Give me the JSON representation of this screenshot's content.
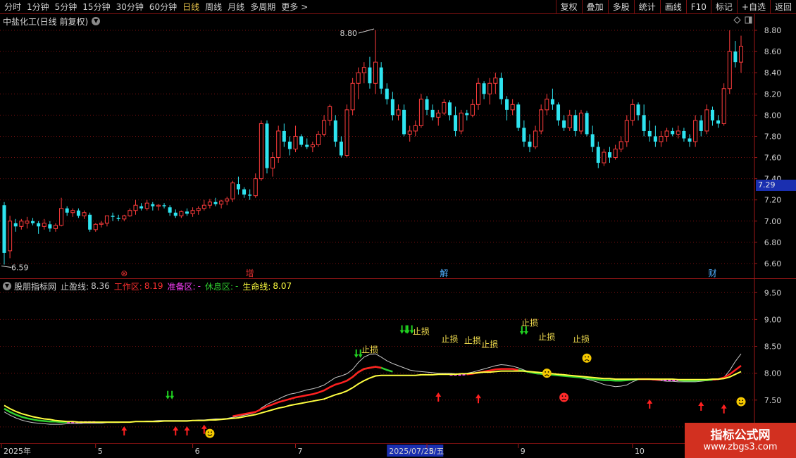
{
  "toolbar": {
    "period_tabs": [
      "分时",
      "1分钟",
      "5分钟",
      "15分钟",
      "30分钟",
      "60分钟",
      "日线",
      "周线",
      "月线",
      "多周期",
      "更多"
    ],
    "active_tab": "日线",
    "buttons": [
      "复权",
      "叠加",
      "多股",
      "统计",
      "画线",
      "F10",
      "标记",
      "+自选",
      "返回"
    ]
  },
  "main_chart": {
    "title": "中盐化工(日线 前复权)",
    "current_price": "7.29",
    "high_label": "8.80",
    "low_label": "6.59",
    "event_markers": [
      {
        "text": "⊗",
        "color": "#e03030",
        "index": 21
      },
      {
        "text": "增",
        "color": "#e03030",
        "index": 43
      },
      {
        "text": "解",
        "color": "#4fb0ff",
        "index": 77
      },
      {
        "text": "财",
        "color": "#4fb0ff",
        "index": 124
      }
    ]
  },
  "indicator": {
    "name": "股朋指标网",
    "stop_profit_label": "止盈线:",
    "stop_profit_value": "8.36",
    "work_label": "工作区:",
    "work_value": "8.19",
    "prep_label": "准备区:",
    "prep_value": "-",
    "rest_label": "休息区:",
    "rest_value": "-",
    "life_label": "生命线:",
    "life_value": "8.07",
    "stop_loss_text": "止损",
    "colors": {
      "work": "#ff2020",
      "prep": "#ff40ff",
      "rest": "#30d030",
      "life": "#ffff40",
      "stop_profit": "#c8c8c8"
    }
  },
  "date_axis": {
    "labels": [
      {
        "text": "2025年",
        "index": 0
      },
      {
        "text": "5",
        "index": 16
      },
      {
        "text": "6",
        "index": 33
      },
      {
        "text": "7",
        "index": 51
      },
      {
        "text": "2025/07/25/五",
        "index": 67,
        "highlight": true
      },
      {
        "text": "8",
        "index": 74
      },
      {
        "text": "9",
        "index": 90
      },
      {
        "text": "10",
        "index": 110
      },
      {
        "text": "11",
        "index": 123
      }
    ]
  },
  "watermark": {
    "line1": "指标公式网",
    "line2": "www.zbgs3.com"
  },
  "chart_data": {
    "type": "candlestick",
    "ylim": [
      6.52,
      8.9
    ],
    "yticks": [
      6.6,
      6.8,
      7.0,
      7.2,
      7.4,
      7.6,
      7.8,
      8.0,
      8.2,
      8.4,
      8.6,
      8.8
    ],
    "indicator_ylim": [
      6.75,
      9.7
    ],
    "indicator_yticks": [
      7.0,
      7.5,
      8.0,
      8.5,
      9.0,
      9.5
    ],
    "candles_ohlc": [
      [
        7.15,
        7.18,
        6.59,
        6.7
      ],
      [
        6.72,
        7.05,
        6.65,
        7.0
      ],
      [
        6.98,
        7.02,
        6.9,
        6.95
      ],
      [
        6.95,
        7.02,
        6.92,
        7.0
      ],
      [
        6.98,
        7.04,
        6.93,
        7.0
      ],
      [
        7.0,
        7.03,
        6.96,
        6.98
      ],
      [
        6.98,
        7.0,
        6.88,
        6.95
      ],
      [
        6.95,
        7.02,
        6.92,
        6.98
      ],
      [
        6.97,
        7.0,
        6.9,
        6.93
      ],
      [
        6.93,
        6.98,
        6.9,
        6.96
      ],
      [
        6.96,
        7.22,
        6.95,
        7.12
      ],
      [
        7.12,
        7.14,
        7.05,
        7.08
      ],
      [
        7.08,
        7.12,
        7.04,
        7.1
      ],
      [
        7.1,
        7.12,
        7.03,
        7.05
      ],
      [
        7.05,
        7.1,
        7.02,
        7.08
      ],
      [
        7.06,
        7.08,
        6.9,
        6.92
      ],
      [
        6.92,
        6.98,
        6.9,
        6.97
      ],
      [
        6.97,
        7.0,
        6.94,
        6.98
      ],
      [
        6.98,
        7.04,
        6.95,
        7.05
      ],
      [
        7.05,
        7.08,
        7.0,
        7.04
      ],
      [
        7.03,
        7.06,
        7.0,
        7.02
      ],
      [
        7.02,
        7.06,
        7.0,
        7.05
      ],
      [
        7.05,
        7.12,
        7.04,
        7.1
      ],
      [
        7.1,
        7.2,
        7.06,
        7.15
      ],
      [
        7.14,
        7.17,
        7.1,
        7.12
      ],
      [
        7.12,
        7.2,
        7.1,
        7.17
      ],
      [
        7.16,
        7.18,
        7.1,
        7.14
      ],
      [
        7.14,
        7.16,
        7.1,
        7.15
      ],
      [
        7.15,
        7.17,
        7.12,
        7.14
      ],
      [
        7.13,
        7.15,
        7.05,
        7.08
      ],
      [
        7.08,
        7.11,
        7.03,
        7.05
      ],
      [
        7.05,
        7.1,
        7.03,
        7.09
      ],
      [
        7.09,
        7.12,
        7.05,
        7.07
      ],
      [
        7.07,
        7.13,
        7.04,
        7.1
      ],
      [
        7.1,
        7.14,
        7.06,
        7.12
      ],
      [
        7.12,
        7.2,
        7.1,
        7.15
      ],
      [
        7.15,
        7.21,
        7.12,
        7.18
      ],
      [
        7.18,
        7.22,
        7.14,
        7.16
      ],
      [
        7.16,
        7.2,
        7.12,
        7.19
      ],
      [
        7.19,
        7.23,
        7.15,
        7.21
      ],
      [
        7.21,
        7.38,
        7.18,
        7.36
      ],
      [
        7.35,
        7.42,
        7.25,
        7.3
      ],
      [
        7.3,
        7.32,
        7.22,
        7.25
      ],
      [
        7.25,
        7.3,
        7.2,
        7.24
      ],
      [
        7.24,
        7.45,
        7.22,
        7.4
      ],
      [
        7.4,
        7.95,
        7.38,
        7.92
      ],
      [
        7.92,
        7.95,
        7.45,
        7.5
      ],
      [
        7.5,
        7.65,
        7.42,
        7.6
      ],
      [
        7.6,
        7.9,
        7.55,
        7.85
      ],
      [
        7.85,
        7.92,
        7.7,
        7.75
      ],
      [
        7.75,
        7.8,
        7.62,
        7.68
      ],
      [
        7.68,
        7.9,
        7.65,
        7.8
      ],
      [
        7.8,
        7.82,
        7.7,
        7.72
      ],
      [
        7.72,
        7.78,
        7.68,
        7.7
      ],
      [
        7.7,
        7.75,
        7.65,
        7.72
      ],
      [
        7.72,
        7.85,
        7.7,
        7.82
      ],
      [
        7.82,
        8.0,
        7.8,
        7.95
      ],
      [
        7.95,
        8.1,
        7.9,
        8.08
      ],
      [
        7.95,
        8.0,
        7.7,
        7.75
      ],
      [
        7.75,
        7.8,
        7.6,
        7.62
      ],
      [
        7.62,
        8.1,
        7.6,
        8.05
      ],
      [
        8.05,
        8.35,
        8.0,
        8.3
      ],
      [
        8.3,
        8.45,
        8.15,
        8.4
      ],
      [
        8.4,
        8.5,
        8.3,
        8.45
      ],
      [
        8.45,
        8.55,
        8.25,
        8.3
      ],
      [
        8.3,
        8.8,
        8.2,
        8.5
      ],
      [
        8.45,
        8.5,
        8.2,
        8.25
      ],
      [
        8.25,
        8.3,
        8.1,
        8.15
      ],
      [
        8.15,
        8.22,
        7.95,
        8.0
      ],
      [
        8.0,
        8.1,
        7.95,
        8.05
      ],
      [
        8.05,
        8.1,
        7.8,
        7.82
      ],
      [
        7.82,
        7.9,
        7.75,
        7.85
      ],
      [
        7.85,
        7.95,
        7.8,
        7.9
      ],
      [
        7.9,
        8.2,
        7.88,
        8.15
      ],
      [
        8.15,
        8.18,
        8.0,
        8.05
      ],
      [
        8.05,
        8.1,
        7.95,
        7.98
      ],
      [
        7.98,
        8.05,
        7.9,
        8.02
      ],
      [
        8.02,
        8.15,
        8.0,
        8.12
      ],
      [
        8.12,
        8.14,
        7.95,
        8.0
      ],
      [
        8.0,
        8.08,
        7.8,
        7.85
      ],
      [
        7.85,
        8.05,
        7.82,
        8.02
      ],
      [
        8.02,
        8.05,
        7.95,
        8.0
      ],
      [
        8.0,
        8.15,
        7.98,
        8.1
      ],
      [
        8.1,
        8.35,
        8.05,
        8.3
      ],
      [
        8.3,
        8.32,
        8.15,
        8.2
      ],
      [
        8.2,
        8.35,
        8.1,
        8.3
      ],
      [
        8.3,
        8.4,
        8.2,
        8.35
      ],
      [
        8.35,
        8.4,
        8.1,
        8.15
      ],
      [
        8.15,
        8.18,
        7.95,
        8.05
      ],
      [
        8.05,
        8.15,
        8.0,
        8.1
      ],
      [
        8.1,
        8.12,
        7.85,
        7.88
      ],
      [
        7.88,
        7.95,
        7.7,
        7.75
      ],
      [
        7.75,
        7.82,
        7.65,
        7.7
      ],
      [
        7.7,
        7.9,
        7.68,
        7.85
      ],
      [
        7.85,
        8.1,
        7.82,
        8.05
      ],
      [
        8.05,
        8.2,
        8.0,
        8.15
      ],
      [
        8.15,
        8.25,
        8.05,
        8.1
      ],
      [
        8.1,
        8.12,
        7.9,
        7.95
      ],
      [
        7.95,
        8.0,
        7.85,
        7.88
      ],
      [
        7.88,
        8.05,
        7.85,
        8.0
      ],
      [
        8.0,
        8.05,
        7.8,
        7.85
      ],
      [
        7.85,
        8.05,
        7.82,
        8.02
      ],
      [
        8.02,
        8.04,
        7.8,
        7.82
      ],
      [
        7.82,
        7.9,
        7.65,
        7.7
      ],
      [
        7.7,
        7.75,
        7.5,
        7.55
      ],
      [
        7.55,
        7.68,
        7.52,
        7.65
      ],
      [
        7.65,
        7.7,
        7.55,
        7.6
      ],
      [
        7.6,
        7.72,
        7.58,
        7.68
      ],
      [
        7.68,
        7.8,
        7.65,
        7.75
      ],
      [
        7.75,
        8.0,
        7.7,
        7.95
      ],
      [
        7.95,
        8.15,
        7.9,
        8.1
      ],
      [
        8.1,
        8.12,
        7.95,
        8.0
      ],
      [
        8.0,
        8.1,
        7.8,
        7.85
      ],
      [
        7.85,
        7.95,
        7.75,
        7.8
      ],
      [
        7.8,
        7.9,
        7.7,
        7.75
      ],
      [
        7.75,
        7.85,
        7.7,
        7.8
      ],
      [
        7.8,
        7.88,
        7.75,
        7.85
      ],
      [
        7.85,
        7.88,
        7.8,
        7.82
      ],
      [
        7.82,
        7.9,
        7.78,
        7.85
      ],
      [
        7.85,
        7.88,
        7.75,
        7.78
      ],
      [
        7.78,
        7.82,
        7.7,
        7.75
      ],
      [
        7.75,
        8.0,
        7.7,
        7.95
      ],
      [
        7.95,
        8.0,
        7.8,
        7.85
      ],
      [
        7.85,
        8.1,
        7.82,
        8.05
      ],
      [
        8.05,
        8.08,
        7.9,
        7.95
      ],
      [
        7.95,
        8.0,
        7.88,
        7.92
      ],
      [
        7.92,
        8.3,
        7.9,
        8.25
      ],
      [
        8.25,
        8.8,
        8.2,
        8.6
      ],
      [
        8.6,
        8.7,
        8.45,
        8.5
      ],
      [
        8.5,
        8.75,
        8.4,
        8.65
      ]
    ],
    "stop_profit_line": [
      7.28,
      7.22,
      7.17,
      7.13,
      7.1,
      7.08,
      7.07,
      7.06,
      7.05,
      7.05,
      7.05,
      7.06,
      7.06,
      7.06,
      7.07,
      7.07,
      7.07,
      7.07,
      7.08,
      7.08,
      7.08,
      7.09,
      7.09,
      7.1,
      7.1,
      7.11,
      7.11,
      7.12,
      7.12,
      7.12,
      7.12,
      7.12,
      7.12,
      7.12,
      7.13,
      7.13,
      7.14,
      7.15,
      7.15,
      7.16,
      7.18,
      7.2,
      7.22,
      7.24,
      7.27,
      7.35,
      7.42,
      7.47,
      7.52,
      7.57,
      7.61,
      7.63,
      7.66,
      7.69,
      7.71,
      7.74,
      7.78,
      7.85,
      7.92,
      7.95,
      7.99,
      8.07,
      8.2,
      8.3,
      8.35,
      8.36,
      8.3,
      8.23,
      8.18,
      8.14,
      8.1,
      8.06,
      8.04,
      8.03,
      8.02,
      8.01,
      8.0,
      8.0,
      8.0,
      7.99,
      7.99,
      8.0,
      8.02,
      8.05,
      8.08,
      8.11,
      8.14,
      8.16,
      8.15,
      8.13,
      8.1,
      8.06,
      8.02,
      7.99,
      7.98,
      7.98,
      7.98,
      7.97,
      7.96,
      7.95,
      7.93,
      7.91,
      7.89,
      7.86,
      7.83,
      7.79,
      7.77,
      7.75,
      7.76,
      7.78,
      7.84,
      7.88,
      7.89,
      7.88,
      7.87,
      7.86,
      7.85,
      7.85,
      7.84,
      7.84,
      7.84,
      7.84,
      7.85,
      7.86,
      7.87,
      7.88,
      7.92,
      8.05,
      8.22,
      8.36
    ],
    "work_line": [
      7.34,
      7.28,
      7.23,
      7.19,
      7.16,
      7.14,
      7.12,
      7.11,
      7.1,
      7.1,
      7.09,
      7.09,
      7.09,
      7.09,
      7.09,
      7.09,
      7.09,
      7.09,
      7.09,
      7.09,
      7.09,
      7.09,
      7.1,
      7.1,
      7.1,
      7.1,
      7.11,
      7.11,
      7.11,
      7.12,
      7.12,
      7.12,
      7.12,
      7.13,
      7.13,
      7.14,
      7.15,
      7.16,
      7.17,
      7.18,
      7.2,
      7.22,
      7.24,
      7.26,
      7.28,
      7.33,
      7.38,
      7.42,
      7.46,
      7.49,
      7.52,
      7.55,
      7.57,
      7.59,
      7.61,
      7.64,
      7.68,
      7.74,
      7.79,
      7.82,
      7.86,
      7.93,
      8.02,
      8.08,
      8.1,
      8.12,
      8.1,
      8.06,
      8.03,
      8.0,
      7.98,
      7.97,
      7.96,
      7.96,
      7.96,
      7.96,
      7.96,
      7.96,
      7.97,
      7.97,
      7.97,
      7.98,
      7.99,
      8.01,
      8.03,
      8.05,
      8.07,
      8.08,
      8.08,
      8.08,
      8.06,
      8.04,
      8.02,
      8.0,
      7.99,
      7.98,
      7.97,
      7.96,
      7.95,
      7.94,
      7.93,
      7.92,
      7.91,
      7.89,
      7.88,
      7.87,
      7.87,
      7.86,
      7.86,
      7.87,
      7.88,
      7.89,
      7.89,
      7.89,
      7.88,
      7.88,
      7.87,
      7.87,
      7.87,
      7.86,
      7.86,
      7.86,
      7.87,
      7.87,
      7.88,
      7.89,
      7.92,
      7.98,
      8.06,
      8.14
    ],
    "work_segments": [
      [
        40,
        66
      ],
      [
        81,
        90
      ],
      [
        111,
        115
      ],
      [
        124,
        135
      ]
    ],
    "prep_segments": [
      [
        11,
        16
      ],
      [
        78,
        81
      ],
      [
        114,
        118
      ]
    ],
    "rest_segments": [
      [
        0,
        11
      ],
      [
        60,
        68
      ],
      [
        90,
        111
      ],
      [
        118,
        124
      ]
    ],
    "life_line": [
      7.4,
      7.34,
      7.29,
      7.25,
      7.22,
      7.19,
      7.17,
      7.15,
      7.14,
      7.12,
      7.11,
      7.1,
      7.1,
      7.09,
      7.09,
      7.09,
      7.09,
      7.09,
      7.09,
      7.09,
      7.09,
      7.09,
      7.09,
      7.1,
      7.1,
      7.1,
      7.1,
      7.1,
      7.11,
      7.11,
      7.11,
      7.11,
      7.11,
      7.12,
      7.12,
      7.12,
      7.13,
      7.13,
      7.14,
      7.15,
      7.16,
      7.17,
      7.19,
      7.21,
      7.23,
      7.26,
      7.29,
      7.32,
      7.35,
      7.37,
      7.4,
      7.42,
      7.44,
      7.46,
      7.48,
      7.5,
      7.52,
      7.56,
      7.6,
      7.63,
      7.67,
      7.73,
      7.8,
      7.86,
      7.91,
      7.95,
      7.96,
      7.96,
      7.96,
      7.96,
      7.96,
      7.96,
      7.96,
      7.97,
      7.97,
      7.97,
      7.98,
      7.98,
      7.98,
      7.98,
      7.99,
      7.99,
      8.0,
      8.01,
      8.02,
      8.02,
      8.03,
      8.04,
      8.04,
      8.04,
      8.04,
      8.04,
      8.03,
      8.02,
      8.01,
      8.0,
      7.99,
      7.98,
      7.97,
      7.96,
      7.95,
      7.94,
      7.93,
      7.92,
      7.91,
      7.9,
      7.9,
      7.89,
      7.89,
      7.89,
      7.89,
      7.89,
      7.89,
      7.89,
      7.89,
      7.89,
      7.89,
      7.89,
      7.88,
      7.88,
      7.88,
      7.88,
      7.88,
      7.88,
      7.89,
      7.89,
      7.9,
      7.93,
      7.98,
      8.03
    ],
    "signals": [
      {
        "type": "up",
        "index": 21,
        "value": 6.92
      },
      {
        "type": "up",
        "index": 30,
        "value": 6.92
      },
      {
        "type": "up",
        "index": 32,
        "value": 6.92
      },
      {
        "type": "up",
        "index": 35,
        "value": 6.95
      },
      {
        "type": "smile",
        "index": 36,
        "value": 6.88
      },
      {
        "type": "down",
        "index": 29,
        "value": 7.58
      },
      {
        "type": "down",
        "index": 62,
        "value": 8.35
      },
      {
        "type": "down",
        "index": 70,
        "value": 8.8
      },
      {
        "type": "down",
        "index": 71,
        "value": 8.8
      },
      {
        "type": "up",
        "index": 76,
        "value": 7.55
      },
      {
        "type": "up",
        "index": 83,
        "value": 7.52
      },
      {
        "type": "down",
        "index": 91,
        "value": 8.78
      },
      {
        "type": "frown",
        "index": 95,
        "value": 8.0
      },
      {
        "type": "frown-red",
        "index": 98,
        "value": 7.55
      },
      {
        "type": "frown",
        "index": 102,
        "value": 8.28
      },
      {
        "type": "up",
        "index": 113,
        "value": 7.42
      },
      {
        "type": "up",
        "index": 122,
        "value": 7.38
      },
      {
        "type": "up",
        "index": 126,
        "value": 7.33
      },
      {
        "type": "smile",
        "index": 129,
        "value": 7.47
      }
    ],
    "stop_loss_labels": [
      {
        "index": 64,
        "value": 8.38
      },
      {
        "index": 73,
        "value": 8.72
      },
      {
        "index": 78,
        "value": 8.58
      },
      {
        "index": 82,
        "value": 8.55
      },
      {
        "index": 85,
        "value": 8.48
      },
      {
        "index": 92,
        "value": 8.88
      },
      {
        "index": 95,
        "value": 8.62
      },
      {
        "index": 101,
        "value": 8.58
      }
    ]
  }
}
